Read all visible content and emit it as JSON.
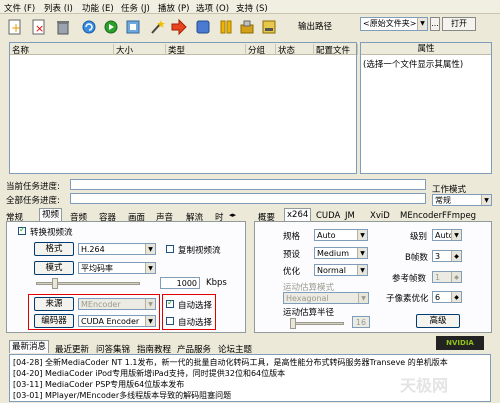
{
  "menu": [
    "文件 (F)",
    "列表 (I)",
    "功能 (E)",
    "任务 (J)",
    "播放 (P)",
    "选项 (O)",
    "支持 (S)"
  ],
  "toolbar": {
    "icons": [
      "new-file-icon",
      "delete-icon",
      "trash-icon",
      "refresh-icon",
      "play-icon",
      "settings-icon",
      "wand-icon",
      "arrow-right-icon",
      "stop-icon",
      "pause-icon",
      "tool-icon",
      "hammer-icon"
    ],
    "output_path_label": "输出路径",
    "output_path_value": "<原始文件夹>",
    "browse_label": "...",
    "open_label": "打开"
  },
  "filelist": {
    "columns": [
      "名称",
      "大小",
      "类型",
      "分组",
      "状态",
      "配置文件"
    ]
  },
  "properties": {
    "header": "属性",
    "hint": "(选择一个文件显示其属性)"
  },
  "progress": {
    "current_label": "当前任务进度:",
    "all_label": "全部任务进度:"
  },
  "work_mode": {
    "label": "工作模式",
    "value": "常规"
  },
  "left_tabs": [
    "常规",
    "视频",
    "音频",
    "容器",
    "画面",
    "声音",
    "解流",
    "时"
  ],
  "left_panel": {
    "enable_video": "转换视频流",
    "format_button": "格式",
    "format_value": "H.264",
    "copy_stream": "复制视频流",
    "mode_button": "模式",
    "mode_value": "平均码率",
    "bitrate_value": "1000",
    "bitrate_unit": "Kbps",
    "source_button": "来源",
    "source_value": "MEncoder",
    "auto_select_1": "自动选择",
    "encoder_button": "编码器",
    "encoder_value": "CUDA Encoder",
    "auto_select_2": "自动选择"
  },
  "right_tabs": [
    "概要",
    "x264",
    "CUDA",
    "JM",
    "XviD",
    "MEncoder",
    "FFmpeg"
  ],
  "right_panel": {
    "profile_label": "规格",
    "profile_value": "Auto",
    "level_label": "级别",
    "level_value": "Auto",
    "preset_label": "预设",
    "preset_value": "Medium",
    "bframes_label": "B帧数",
    "bframes_value": "3",
    "optimize_label": "优化",
    "optimize_value": "Normal",
    "ref_label": "参考帧数",
    "ref_value": "1",
    "me_label": "运动估算模式",
    "me_value": "Hexagonal",
    "subme_label": "子像素优化",
    "subme_value": "6",
    "merange_label": "运动估算半径",
    "merange_value": "16",
    "advanced_button": "高级"
  },
  "bottom_tabs": [
    "最新消息",
    "最近更新",
    "问答集锦",
    "指南教程",
    "产品服务",
    "论坛主题"
  ],
  "news": [
    "[04-28] 全新MediaCoder NT 1.1发布，新一代的批量自动化转码工具，是高性能分布式转码服务器Transeve 的单机版本",
    "[04-20] MediaCoder iPod专用版新增iPad支持，同时提供32位和64位版本",
    "[03-11] MediaCoder PSP专用版64位版本发布",
    "[03-01] MPlayer/MEncoder多线程版本导致的解码阻塞问题"
  ],
  "nvidia_badge": "NVIDIA",
  "watermark": "天极网"
}
